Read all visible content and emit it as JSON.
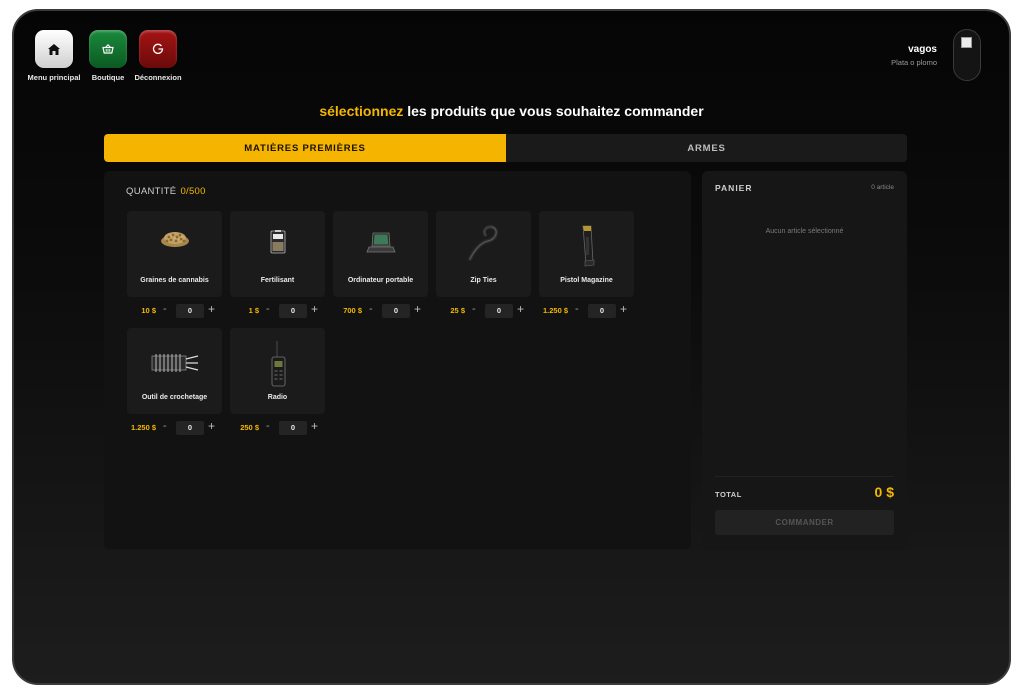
{
  "nav": {
    "home_label": "Menu principal",
    "shop_label": "Boutique",
    "logout_label": "Déconnexion"
  },
  "user": {
    "name": "vagos",
    "subtitle": "Plata o plomo"
  },
  "heading": {
    "highlight": "sélectionnez",
    "rest": " les produits que vous souhaitez commander"
  },
  "tabs": [
    {
      "label": "MATIÈRES PREMIÈRES",
      "active": true
    },
    {
      "label": "ARMES",
      "active": false
    }
  ],
  "quantity": {
    "label": "QUANTITÉ",
    "value": "0/500"
  },
  "products": [
    {
      "name": "Graines de cannabis",
      "price": "10 $",
      "qty": "0",
      "icon": "seeds-icon"
    },
    {
      "name": "Fertilisant",
      "price": "1 $",
      "qty": "0",
      "icon": "fertilizer-bag-icon"
    },
    {
      "name": "Ordinateur portable",
      "price": "700 $",
      "qty": "0",
      "icon": "laptop-icon"
    },
    {
      "name": "Zip Ties",
      "price": "25 $",
      "qty": "0",
      "icon": "zip-tie-icon"
    },
    {
      "name": "Pistol Magazine",
      "price": "1.250 $",
      "qty": "0",
      "icon": "pistol-magazine-icon"
    },
    {
      "name": "Outil de crochetage",
      "price": "1.250 $",
      "qty": "0",
      "icon": "lockpick-tool-icon"
    },
    {
      "name": "Radio",
      "price": "250 $",
      "qty": "0",
      "icon": "radio-icon"
    }
  ],
  "controls": {
    "minus": "-",
    "plus": "+"
  },
  "cart": {
    "title": "PANIER",
    "count": "0 article",
    "empty": "Aucun article sélectionné",
    "total_label": "TOTAL",
    "total_value": "0 $",
    "order_label": "COMMANDER"
  },
  "colors": {
    "accent": "#f5b800",
    "shop": "#1a8a3c",
    "logout": "#a51414"
  }
}
